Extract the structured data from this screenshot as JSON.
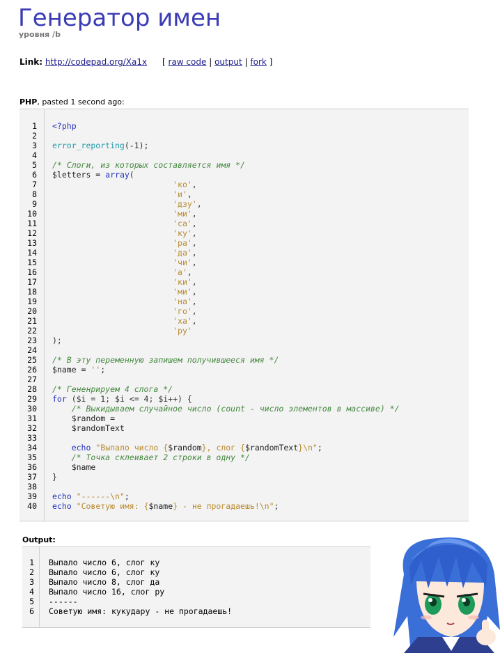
{
  "header": {
    "title": "Генератор имен",
    "subtitle": "уровня /b"
  },
  "link_bar": {
    "label": "Link:",
    "url": "http://codepad.org/Xa1x",
    "open_bracket": "[",
    "raw_code": "raw code",
    "sep1": "|",
    "output": "output",
    "sep2": "|",
    "fork": "fork",
    "close_bracket": "]"
  },
  "paste_info": {
    "language": "PHP",
    "text": ", pasted 1 second ago:"
  },
  "code_lines": [
    [
      [
        "kw",
        "<?php"
      ]
    ],
    [],
    [
      [
        "fn",
        "error_reporting"
      ],
      [
        "op",
        "(-1);"
      ]
    ],
    [],
    [
      [
        "cm",
        "/* Слоги, из которых составляется имя */"
      ]
    ],
    [
      [
        "vr",
        "$letters = "
      ],
      [
        "kw",
        "array"
      ],
      [
        "op",
        "("
      ]
    ],
    [
      [
        "op",
        "                         "
      ],
      [
        "st",
        "'ко'"
      ],
      [
        "op",
        ","
      ]
    ],
    [
      [
        "op",
        "                         "
      ],
      [
        "st",
        "'и'"
      ],
      [
        "op",
        ","
      ]
    ],
    [
      [
        "op",
        "                         "
      ],
      [
        "st",
        "'дзу'"
      ],
      [
        "op",
        ","
      ]
    ],
    [
      [
        "op",
        "                         "
      ],
      [
        "st",
        "'ми'"
      ],
      [
        "op",
        ","
      ]
    ],
    [
      [
        "op",
        "                         "
      ],
      [
        "st",
        "'са'"
      ],
      [
        "op",
        ","
      ]
    ],
    [
      [
        "op",
        "                         "
      ],
      [
        "st",
        "'ку'"
      ],
      [
        "op",
        ","
      ]
    ],
    [
      [
        "op",
        "                         "
      ],
      [
        "st",
        "'ра'"
      ],
      [
        "op",
        ","
      ]
    ],
    [
      [
        "op",
        "                         "
      ],
      [
        "st",
        "'да'"
      ],
      [
        "op",
        ","
      ]
    ],
    [
      [
        "op",
        "                         "
      ],
      [
        "st",
        "'чи'"
      ],
      [
        "op",
        ","
      ]
    ],
    [
      [
        "op",
        "                         "
      ],
      [
        "st",
        "'а'"
      ],
      [
        "op",
        ","
      ]
    ],
    [
      [
        "op",
        "                         "
      ],
      [
        "st",
        "'ки'"
      ],
      [
        "op",
        ","
      ]
    ],
    [
      [
        "op",
        "                         "
      ],
      [
        "st",
        "'ми'"
      ],
      [
        "op",
        ","
      ]
    ],
    [
      [
        "op",
        "                         "
      ],
      [
        "st",
        "'на'"
      ],
      [
        "op",
        ","
      ]
    ],
    [
      [
        "op",
        "                         "
      ],
      [
        "st",
        "'го'"
      ],
      [
        "op",
        ","
      ]
    ],
    [
      [
        "op",
        "                         "
      ],
      [
        "st",
        "'ха'"
      ],
      [
        "op",
        ","
      ]
    ],
    [
      [
        "op",
        "                         "
      ],
      [
        "st",
        "'ру'"
      ]
    ],
    [
      [
        "op",
        ");"
      ]
    ],
    [],
    [
      [
        "cm",
        "/* В эту переменную запишем получившееся имя */"
      ]
    ],
    [
      [
        "vr",
        "$name = "
      ],
      [
        "st",
        "''"
      ],
      [
        "op",
        ";"
      ]
    ],
    [],
    [
      [
        "cm",
        "/* Гененрируем 4 слога */"
      ]
    ],
    [
      [
        "kw",
        "for"
      ],
      [
        "op",
        " ($i = 1; $i <= 4; $i++) {"
      ]
    ],
    [
      [
        "op",
        "    "
      ],
      [
        "cm",
        "/* Выкидываем случайное число (count - число элементов в массиве) */"
      ]
    ],
    [
      [
        "vr",
        "    $random = "
      ]
    ],
    [
      [
        "vr",
        "    $randomText"
      ]
    ],
    [],
    [
      [
        "op",
        "    "
      ],
      [
        "kw",
        "echo"
      ],
      [
        "op",
        " "
      ],
      [
        "st",
        "\"Выпало число {"
      ],
      [
        "vr",
        "$random"
      ],
      [
        "st",
        "}, слог {"
      ],
      [
        "vr",
        "$randomText"
      ],
      [
        "st",
        "}\\n\""
      ],
      [
        "op",
        ";"
      ]
    ],
    [
      [
        "op",
        "    "
      ],
      [
        "cm",
        "/* Точка склеивает 2 строки в одну */"
      ]
    ],
    [
      [
        "vr",
        "    $name "
      ]
    ],
    [
      [
        "op",
        "}"
      ]
    ],
    [],
    [
      [
        "kw",
        "echo"
      ],
      [
        "op",
        " "
      ],
      [
        "st",
        "\"------\\n\""
      ],
      [
        "op",
        ";"
      ]
    ],
    [
      [
        "kw",
        "echo"
      ],
      [
        "op",
        " "
      ],
      [
        "st",
        "\"Советую имя: {"
      ],
      [
        "vr",
        "$name"
      ],
      [
        "st",
        "} - не прогадаешь!\\n\""
      ],
      [
        "op",
        ";"
      ]
    ]
  ],
  "output_label": "Output:",
  "output_lines": [
    "Выпало число 6, слог ку",
    "Выпало число 6, слог ку",
    "Выпало число 8, слог да",
    "Выпало число 16, слог ру",
    "------",
    "Советую имя: кукудару - не прогадаешь!"
  ]
}
